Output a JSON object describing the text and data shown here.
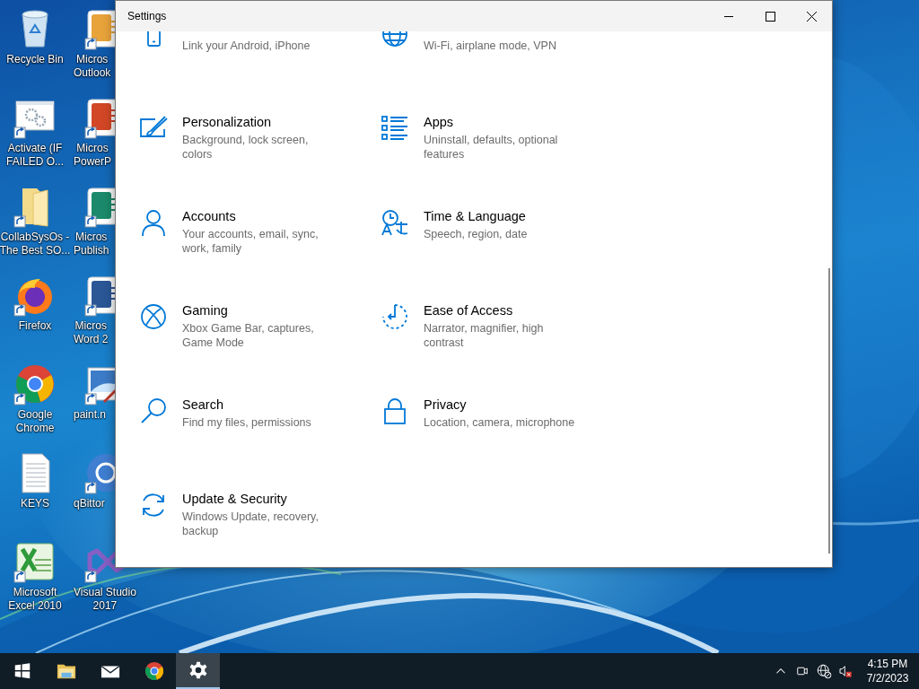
{
  "desktop": {
    "icons": [
      {
        "kind": "recycle-bin",
        "label": [
          "Recycle Bin"
        ],
        "shortcut": false
      },
      {
        "kind": "gears-window",
        "label": [
          "Activate (IF",
          "FAILED O..."
        ],
        "shortcut": true
      },
      {
        "kind": "folder",
        "label": [
          "CollabSysOs -",
          "The Best SO..."
        ],
        "shortcut": true
      },
      {
        "kind": "fox-globe",
        "label": [
          "Firefox"
        ],
        "shortcut": true
      },
      {
        "kind": "ring-globe",
        "label": [
          "Google",
          "Chrome"
        ],
        "shortcut": true
      },
      {
        "kind": "text-file",
        "label": [
          "KEYS"
        ],
        "shortcut": false
      },
      {
        "kind": "spreadsheet",
        "label": [
          "Microsoft",
          "Excel 2010"
        ],
        "shortcut": true
      },
      {
        "kind": "tile",
        "color": "#e8a33a",
        "label": [
          "Micros",
          "Outlook"
        ],
        "shortcut": true
      },
      {
        "kind": "tile",
        "color": "#d24726",
        "label": [
          "Micros",
          "PowerP"
        ],
        "shortcut": true
      },
      {
        "kind": "tile",
        "color": "#1b8a6b",
        "label": [
          "Micros",
          "Publish"
        ],
        "shortcut": true
      },
      {
        "kind": "tile",
        "color": "#2b5797",
        "label": [
          "Micros",
          "Word 2"
        ],
        "shortcut": true
      },
      {
        "kind": "paint",
        "label": [
          "paint.n"
        ],
        "shortcut": true
      },
      {
        "kind": "disc",
        "color": "#3f7ed1",
        "label": [
          "qBittor"
        ],
        "shortcut": true
      },
      {
        "kind": "ribbon",
        "color": "#865fc5",
        "label": [
          "Visual Studio",
          "2017"
        ],
        "shortcut": true
      }
    ]
  },
  "window": {
    "title": "Settings",
    "controls": [
      {
        "kind": "minimize"
      },
      {
        "kind": "maximize"
      },
      {
        "kind": "close"
      }
    ],
    "items": [
      {
        "kind": "phone",
        "description": "Link your Android, iPhone"
      },
      {
        "kind": "network",
        "description": "Wi-Fi, airplane mode, VPN"
      },
      {
        "kind": "personalization",
        "title": "Personalization",
        "description": "Background, lock screen, colors"
      },
      {
        "kind": "apps",
        "title": "Apps",
        "description": "Uninstall, defaults, optional features"
      },
      {
        "kind": "accounts",
        "title": "Accounts",
        "description": "Your accounts, email, sync, work, family"
      },
      {
        "kind": "time",
        "title": "Time & Language",
        "description": "Speech, region, date"
      },
      {
        "kind": "gaming",
        "title": "Gaming",
        "description": "Xbox Game Bar, captures, Game Mode"
      },
      {
        "kind": "ease",
        "title": "Ease of Access",
        "description": "Narrator, magnifier, high contrast"
      },
      {
        "kind": "search",
        "title": "Search",
        "description": "Find my files, permissions"
      },
      {
        "kind": "privacy",
        "title": "Privacy",
        "description": "Location, camera, microphone"
      },
      {
        "kind": "update",
        "title": "Update & Security",
        "description": "Windows Update, recovery, backup"
      }
    ]
  },
  "taskbar": {
    "buttons": [
      {
        "kind": "start",
        "selected": false
      },
      {
        "kind": "explorer",
        "selected": false
      },
      {
        "kind": "mail",
        "selected": false
      },
      {
        "kind": "browser",
        "selected": false
      },
      {
        "kind": "settings",
        "selected": true
      }
    ],
    "tray": [
      {
        "kind": "caret"
      },
      {
        "kind": "meet"
      },
      {
        "kind": "network-off"
      },
      {
        "kind": "volume-muted"
      }
    ],
    "time": "4:15 PM",
    "date": "7/2/2023"
  }
}
